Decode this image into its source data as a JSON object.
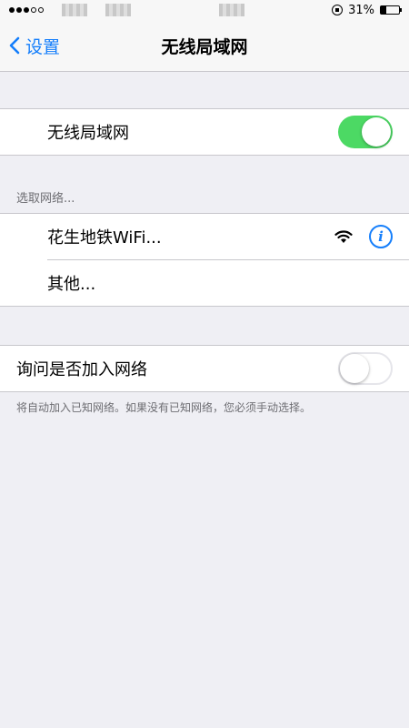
{
  "status": {
    "battery": "31%",
    "battery_level": 0.31
  },
  "nav": {
    "back_label": "设置",
    "title": "无线局域网"
  },
  "wifi": {
    "label": "无线局域网",
    "enabled": true
  },
  "networks": {
    "header": "选取网络...",
    "items": [
      {
        "name": "花生地铁WiFi...",
        "signal_icon": "wifi-icon",
        "info_icon": "info-icon"
      },
      {
        "name": "其他..."
      }
    ]
  },
  "ask_join": {
    "label": "询问是否加入网络",
    "enabled": false,
    "footer": "将自动加入已知网络。如果没有已知网络，您必须手动选择。"
  },
  "colors": {
    "accent": "#147efb",
    "toggle_on": "#4cd964",
    "background": "#efeff4"
  }
}
